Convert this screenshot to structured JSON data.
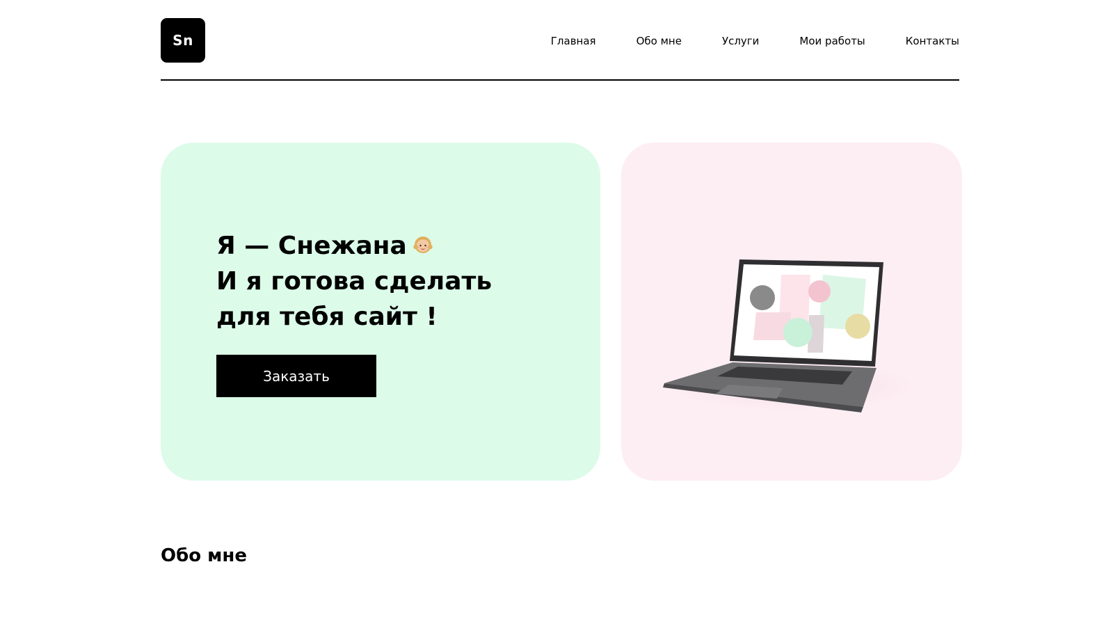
{
  "header": {
    "logo_text": "Sn",
    "nav": [
      {
        "label": "Главная"
      },
      {
        "label": "Обо мне"
      },
      {
        "label": "Услуги"
      },
      {
        "label": "Мои работы"
      },
      {
        "label": "Контакты"
      }
    ]
  },
  "hero": {
    "title_lines": [
      "Я — Снежана",
      "И я готова сделать",
      "для тебя сайт !"
    ],
    "emoji_icon": "girl-emoji-icon",
    "cta_label": "Заказать",
    "bg_color": "#dcfbe9",
    "image_bg_color": "#fdeef3",
    "image_icon": "laptop-illustration"
  },
  "about": {
    "title": "Обо мне"
  }
}
